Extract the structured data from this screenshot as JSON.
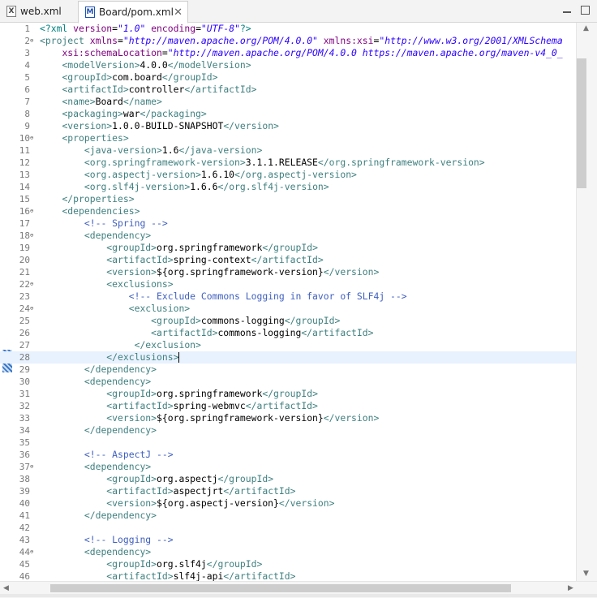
{
  "tabs": [
    {
      "label": "web.xml",
      "icon": "xml-file-icon"
    },
    {
      "label": "Board/pom.xml",
      "icon": "maven-pom-icon",
      "close": "✕"
    }
  ],
  "line_numbers": [
    "1",
    "2",
    "3",
    "4",
    "5",
    "6",
    "7",
    "8",
    "9",
    "10",
    "11",
    "12",
    "13",
    "14",
    "15",
    "16",
    "17",
    "18",
    "19",
    "20",
    "21",
    "22",
    "23",
    "24",
    "25",
    "26",
    "27",
    "28",
    "29",
    "30",
    "31",
    "32",
    "33",
    "34",
    "35",
    "36",
    "37",
    "38",
    "39",
    "40",
    "41",
    "42",
    "43",
    "44",
    "45",
    "46"
  ],
  "fold_marks": {
    "2": "⊖",
    "10": "⊖",
    "16": "⊖",
    "18": "⊖",
    "22": "⊖",
    "24": "⊖",
    "37": "⊖",
    "44": "⊖"
  },
  "code": [
    [
      [
        "pi",
        "<?xml "
      ],
      [
        "a",
        "version"
      ],
      [
        "txt",
        "="
      ],
      [
        "v",
        "\"1.0\""
      ],
      [
        "txt",
        " "
      ],
      [
        "a",
        "encoding"
      ],
      [
        "txt",
        "="
      ],
      [
        "v",
        "\"UTF-8\""
      ],
      [
        "pi",
        "?>"
      ]
    ],
    [
      [
        "t",
        "<project "
      ],
      [
        "a",
        "xmlns"
      ],
      [
        "txt",
        "="
      ],
      [
        "v",
        "\"http://maven.apache.org/POM/4.0.0\""
      ],
      [
        "txt",
        " "
      ],
      [
        "a",
        "xmlns:xsi"
      ],
      [
        "txt",
        "="
      ],
      [
        "v",
        "\"http://www.w3.org/2001/XMLSchema"
      ]
    ],
    [
      [
        "txt",
        "    "
      ],
      [
        "a",
        "xsi:schemaLocation"
      ],
      [
        "txt",
        "="
      ],
      [
        "v",
        "\"http://maven.apache.org/POM/4.0.0 https://maven.apache.org/maven-v4_0_"
      ]
    ],
    [
      [
        "txt",
        "    "
      ],
      [
        "t",
        "<modelVersion>"
      ],
      [
        "txt",
        "4.0.0"
      ],
      [
        "t",
        "</modelVersion>"
      ]
    ],
    [
      [
        "txt",
        "    "
      ],
      [
        "t",
        "<groupId>"
      ],
      [
        "txt",
        "com.board"
      ],
      [
        "t",
        "</groupId>"
      ]
    ],
    [
      [
        "txt",
        "    "
      ],
      [
        "t",
        "<artifactId>"
      ],
      [
        "txt",
        "controller"
      ],
      [
        "t",
        "</artifactId>"
      ]
    ],
    [
      [
        "txt",
        "    "
      ],
      [
        "t",
        "<name>"
      ],
      [
        "txt",
        "Board"
      ],
      [
        "t",
        "</name>"
      ]
    ],
    [
      [
        "txt",
        "    "
      ],
      [
        "t",
        "<packaging>"
      ],
      [
        "txt",
        "war"
      ],
      [
        "t",
        "</packaging>"
      ]
    ],
    [
      [
        "txt",
        "    "
      ],
      [
        "t",
        "<version>"
      ],
      [
        "txt",
        "1.0.0-BUILD-SNAPSHOT"
      ],
      [
        "t",
        "</version>"
      ]
    ],
    [
      [
        "txt",
        "    "
      ],
      [
        "t",
        "<properties>"
      ]
    ],
    [
      [
        "txt",
        "        "
      ],
      [
        "t",
        "<java-version>"
      ],
      [
        "txt",
        "1.6"
      ],
      [
        "t",
        "</java-version>"
      ]
    ],
    [
      [
        "txt",
        "        "
      ],
      [
        "t",
        "<org.springframework-version>"
      ],
      [
        "txt",
        "3.1.1.RELEASE"
      ],
      [
        "t",
        "</org.springframework-version>"
      ]
    ],
    [
      [
        "txt",
        "        "
      ],
      [
        "t",
        "<org.aspectj-version>"
      ],
      [
        "txt",
        "1.6.10"
      ],
      [
        "t",
        "</org.aspectj-version>"
      ]
    ],
    [
      [
        "txt",
        "        "
      ],
      [
        "t",
        "<org.slf4j-version>"
      ],
      [
        "txt",
        "1.6.6"
      ],
      [
        "t",
        "</org.slf4j-version>"
      ]
    ],
    [
      [
        "txt",
        "    "
      ],
      [
        "t",
        "</properties>"
      ]
    ],
    [
      [
        "txt",
        "    "
      ],
      [
        "t",
        "<dependencies>"
      ]
    ],
    [
      [
        "txt",
        "        "
      ],
      [
        "c",
        "<!-- Spring -->"
      ]
    ],
    [
      [
        "txt",
        "        "
      ],
      [
        "t",
        "<dependency>"
      ]
    ],
    [
      [
        "txt",
        "            "
      ],
      [
        "t",
        "<groupId>"
      ],
      [
        "txt",
        "org.springframework"
      ],
      [
        "t",
        "</groupId>"
      ]
    ],
    [
      [
        "txt",
        "            "
      ],
      [
        "t",
        "<artifactId>"
      ],
      [
        "txt",
        "spring-context"
      ],
      [
        "t",
        "</artifactId>"
      ]
    ],
    [
      [
        "txt",
        "            "
      ],
      [
        "t",
        "<version>"
      ],
      [
        "txt",
        "${org.springframework-version}"
      ],
      [
        "t",
        "</version>"
      ]
    ],
    [
      [
        "txt",
        "            "
      ],
      [
        "t",
        "<exclusions>"
      ]
    ],
    [
      [
        "txt",
        "                "
      ],
      [
        "c",
        "<!-- Exclude Commons Logging in favor of SLF4j -->"
      ]
    ],
    [
      [
        "txt",
        "                "
      ],
      [
        "t",
        "<exclusion>"
      ]
    ],
    [
      [
        "txt",
        "                    "
      ],
      [
        "t",
        "<groupId>"
      ],
      [
        "txt",
        "commons-logging"
      ],
      [
        "t",
        "</groupId>"
      ]
    ],
    [
      [
        "txt",
        "                    "
      ],
      [
        "t",
        "<artifactId>"
      ],
      [
        "txt",
        "commons-logging"
      ],
      [
        "t",
        "</artifactId>"
      ]
    ],
    [
      [
        "txt",
        "                 "
      ],
      [
        "t",
        "</exclusion>"
      ]
    ],
    [
      [
        "txt",
        "            "
      ],
      [
        "t",
        "</exclusions>"
      ],
      [
        "caret",
        ""
      ]
    ],
    [
      [
        "txt",
        "        "
      ],
      [
        "t",
        "</dependency>"
      ]
    ],
    [
      [
        "txt",
        "        "
      ],
      [
        "t",
        "<dependency>"
      ]
    ],
    [
      [
        "txt",
        "            "
      ],
      [
        "t",
        "<groupId>"
      ],
      [
        "txt",
        "org.springframework"
      ],
      [
        "t",
        "</groupId>"
      ]
    ],
    [
      [
        "txt",
        "            "
      ],
      [
        "t",
        "<artifactId>"
      ],
      [
        "txt",
        "spring-webmvc"
      ],
      [
        "t",
        "</artifactId>"
      ]
    ],
    [
      [
        "txt",
        "            "
      ],
      [
        "t",
        "<version>"
      ],
      [
        "txt",
        "${org.springframework-version}"
      ],
      [
        "t",
        "</version>"
      ]
    ],
    [
      [
        "txt",
        "        "
      ],
      [
        "t",
        "</dependency>"
      ]
    ],
    [],
    [
      [
        "txt",
        "        "
      ],
      [
        "c",
        "<!-- AspectJ -->"
      ]
    ],
    [
      [
        "txt",
        "        "
      ],
      [
        "t",
        "<dependency>"
      ]
    ],
    [
      [
        "txt",
        "            "
      ],
      [
        "t",
        "<groupId>"
      ],
      [
        "txt",
        "org.aspectj"
      ],
      [
        "t",
        "</groupId>"
      ]
    ],
    [
      [
        "txt",
        "            "
      ],
      [
        "t",
        "<artifactId>"
      ],
      [
        "txt",
        "aspectjrt"
      ],
      [
        "t",
        "</artifactId>"
      ]
    ],
    [
      [
        "txt",
        "            "
      ],
      [
        "t",
        "<version>"
      ],
      [
        "txt",
        "${org.aspectj-version}"
      ],
      [
        "t",
        "</version>"
      ]
    ],
    [
      [
        "txt",
        "        "
      ],
      [
        "t",
        "</dependency>"
      ]
    ],
    [],
    [
      [
        "txt",
        "        "
      ],
      [
        "c",
        "<!-- Logging -->"
      ]
    ],
    [
      [
        "txt",
        "        "
      ],
      [
        "t",
        "<dependency>"
      ]
    ],
    [
      [
        "txt",
        "            "
      ],
      [
        "t",
        "<groupId>"
      ],
      [
        "txt",
        "org.slf4j"
      ],
      [
        "t",
        "</groupId>"
      ]
    ],
    [
      [
        "txt",
        "            "
      ],
      [
        "t",
        "<artifactId>"
      ],
      [
        "txt",
        "slf4j-api"
      ],
      [
        "t",
        "</artifactId>"
      ]
    ]
  ],
  "current_line": 28
}
